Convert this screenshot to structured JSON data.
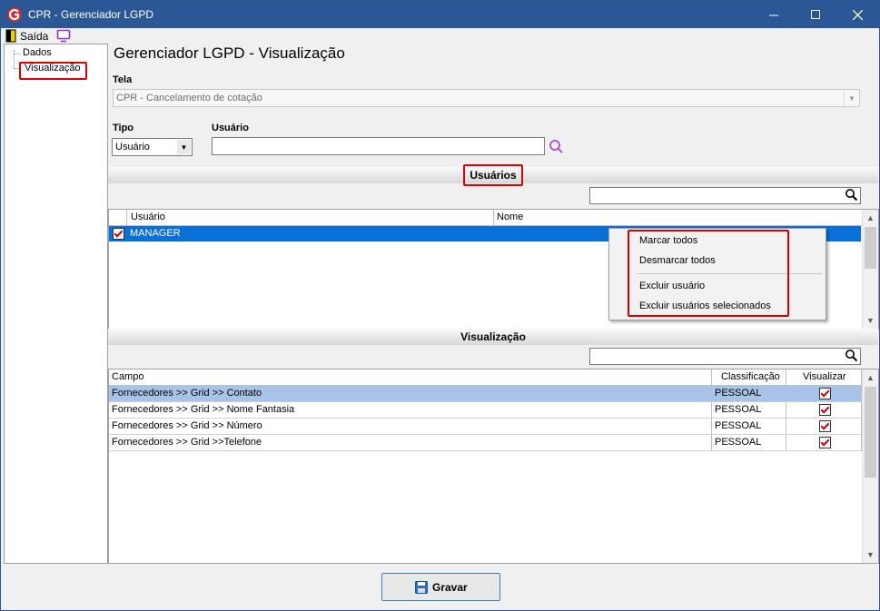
{
  "window": {
    "title": "CPR - Gerenciador LGPD",
    "brand_color": "#2b5797"
  },
  "menubar": {
    "exit_label": "Saída"
  },
  "tree": {
    "items": [
      "Dados",
      "Visualização"
    ],
    "selected": "Visualização"
  },
  "page_title": "Gerenciador LGPD - Visualização",
  "tela": {
    "label": "Tela",
    "value": "CPR - Cancelamento de cotação"
  },
  "tipo": {
    "label": "Tipo",
    "value": "Usuário"
  },
  "usuario": {
    "label": "Usuário",
    "value": ""
  },
  "users_section": {
    "title": "Usuários",
    "search_value": "",
    "columns": [
      "Usuário",
      "Nome"
    ],
    "rows": [
      {
        "checked": true,
        "usuario": "MANAGER",
        "nome": ""
      }
    ]
  },
  "context_menu": {
    "items": [
      "Marcar todos",
      "Desmarcar todos",
      "Excluir usuário",
      "Excluir usuários selecionados"
    ]
  },
  "view_section": {
    "title": "Visualização",
    "search_value": "",
    "columns": [
      "Campo",
      "Classificação",
      "Visualizar"
    ],
    "rows": [
      {
        "campo": "Fornecedores >> Grid >> Contato",
        "classificacao": "PESSOAL",
        "visualizar": true
      },
      {
        "campo": "Fornecedores >> Grid >> Nome Fantasia",
        "classificacao": "PESSOAL",
        "visualizar": true
      },
      {
        "campo": "Fornecedores >> Grid >> Número",
        "classificacao": "PESSOAL",
        "visualizar": true
      },
      {
        "campo": "Fornecedores >> Grid >>Telefone",
        "classificacao": "PESSOAL",
        "visualizar": true
      }
    ]
  },
  "save_button": {
    "label": "Gravar"
  },
  "icons": {
    "app": "app-logo-icon",
    "exit": "exit-door-icon",
    "screen": "monitor-icon",
    "search": "search-icon",
    "save": "floppy-disk-icon"
  }
}
